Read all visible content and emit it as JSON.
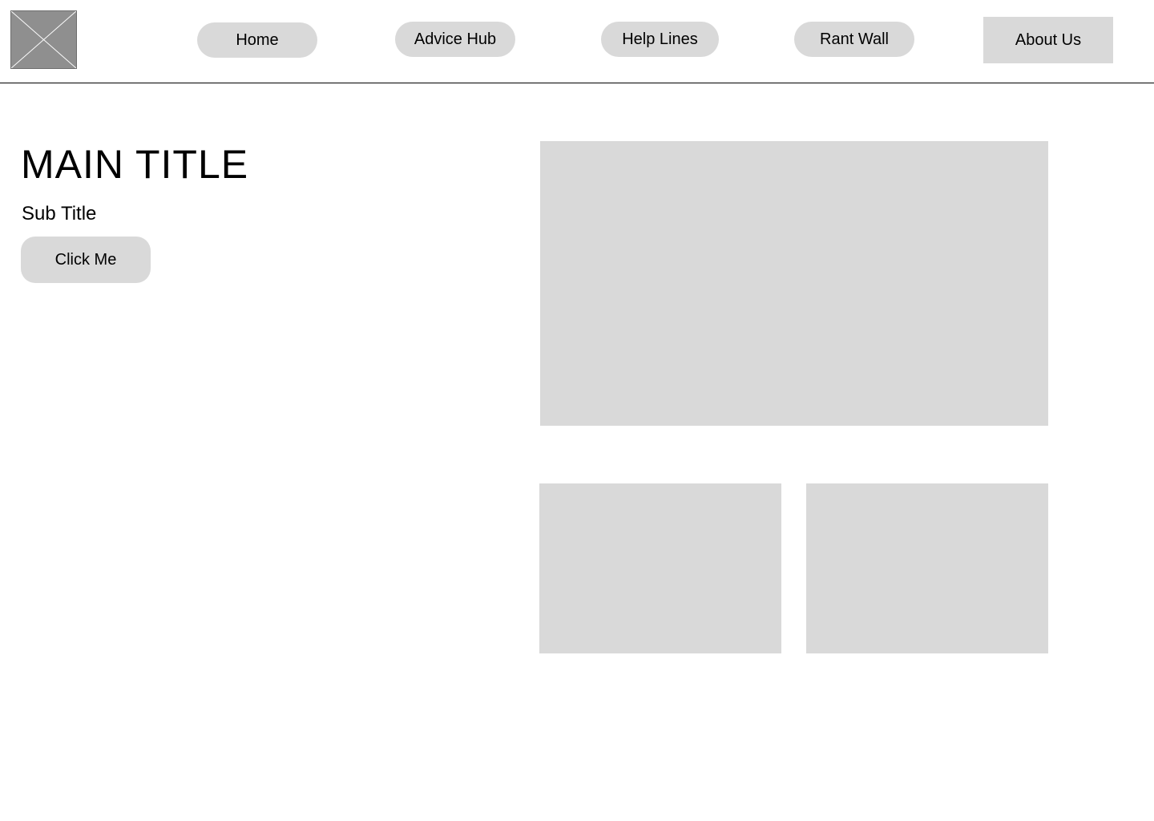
{
  "nav": {
    "items": [
      {
        "label": "Home"
      },
      {
        "label": "Advice Hub"
      },
      {
        "label": "Help Lines"
      },
      {
        "label": "Rant Wall"
      },
      {
        "label": "About Us"
      }
    ]
  },
  "hero": {
    "title": "MAIN TITLE",
    "subtitle": "Sub Title",
    "button_label": "Click Me"
  },
  "colors": {
    "placeholder": "#d9d9d9",
    "logo_placeholder": "#8f8f8f",
    "divider": "#000000"
  },
  "icons": {
    "logo": "image-placeholder-icon"
  }
}
